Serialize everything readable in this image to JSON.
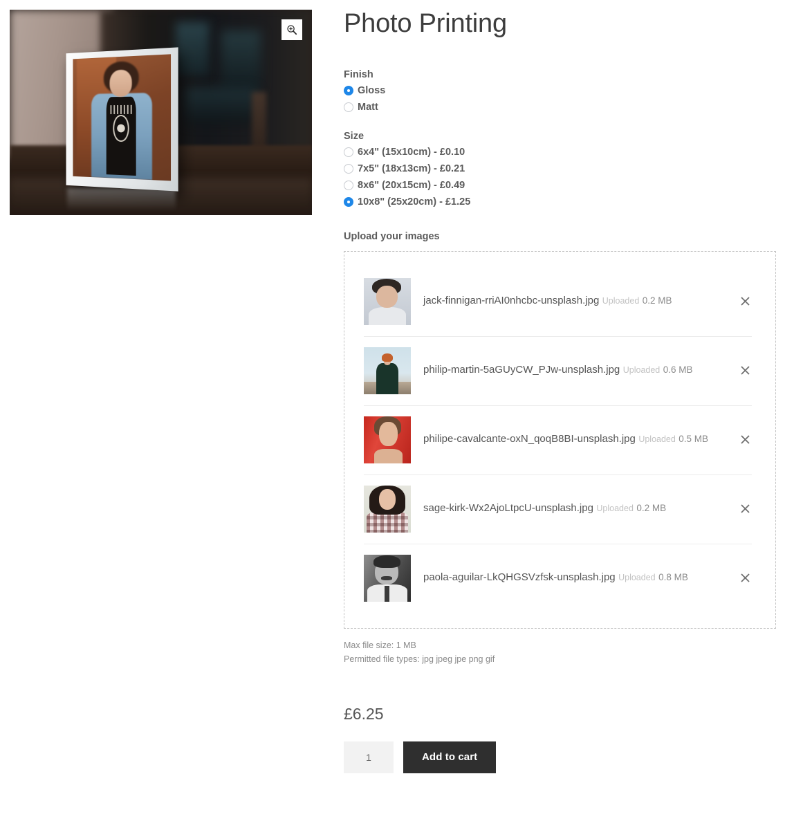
{
  "product": {
    "title": "Photo Printing",
    "price": "£6.25",
    "image_alt": "white-picture-frame-on-table",
    "zoom_icon": "magnifier-plus-icon"
  },
  "options": {
    "finish": {
      "legend": "Finish",
      "choices": [
        {
          "label": "Gloss",
          "selected": true
        },
        {
          "label": "Matt",
          "selected": false
        }
      ]
    },
    "size": {
      "legend": "Size",
      "choices": [
        {
          "label": "6x4\" (15x10cm) - £0.10",
          "selected": false
        },
        {
          "label": "7x5\" (18x13cm) - £0.21",
          "selected": false
        },
        {
          "label": "8x6\" (20x15cm) - £0.49",
          "selected": false
        },
        {
          "label": "10x8\" (25x20cm) - £1.25",
          "selected": true
        }
      ]
    }
  },
  "upload": {
    "legend": "Upload your images",
    "remove_icon": "close-icon",
    "files": [
      {
        "name": "jack-finnigan-rriAI0nhcbc-unsplash.jpg",
        "status": "Uploaded",
        "size": "0.2 MB",
        "thumb": "man-smiling-portrait"
      },
      {
        "name": "philip-martin-5aGUyCW_PJw-unsplash.jpg",
        "status": "Uploaded",
        "size": "0.6 MB",
        "thumb": "red-haired-man-coast"
      },
      {
        "name": "philipe-cavalcante-oxN_qoqB8BI-unsplash.jpg",
        "status": "Uploaded",
        "size": "0.5 MB",
        "thumb": "woman-red-backdrop"
      },
      {
        "name": "sage-kirk-Wx2AjoLtpcU-unsplash.jpg",
        "status": "Uploaded",
        "size": "0.2 MB",
        "thumb": "woman-plaid-shirt"
      },
      {
        "name": "paola-aguilar-LkQHGSVzfsk-unsplash.jpg",
        "status": "Uploaded",
        "size": "0.8 MB",
        "thumb": "older-man-bw-portrait"
      }
    ],
    "max_size_note": "Max file size: 1 MB",
    "permitted_note": "Permitted file types: jpg jpeg jpe png gif"
  },
  "cart": {
    "quantity": "1",
    "add_label": "Add to cart"
  },
  "colors": {
    "accent": "#1e87e8",
    "button": "#2f2f2f",
    "text": "#555555",
    "muted": "#8a8a8a"
  }
}
